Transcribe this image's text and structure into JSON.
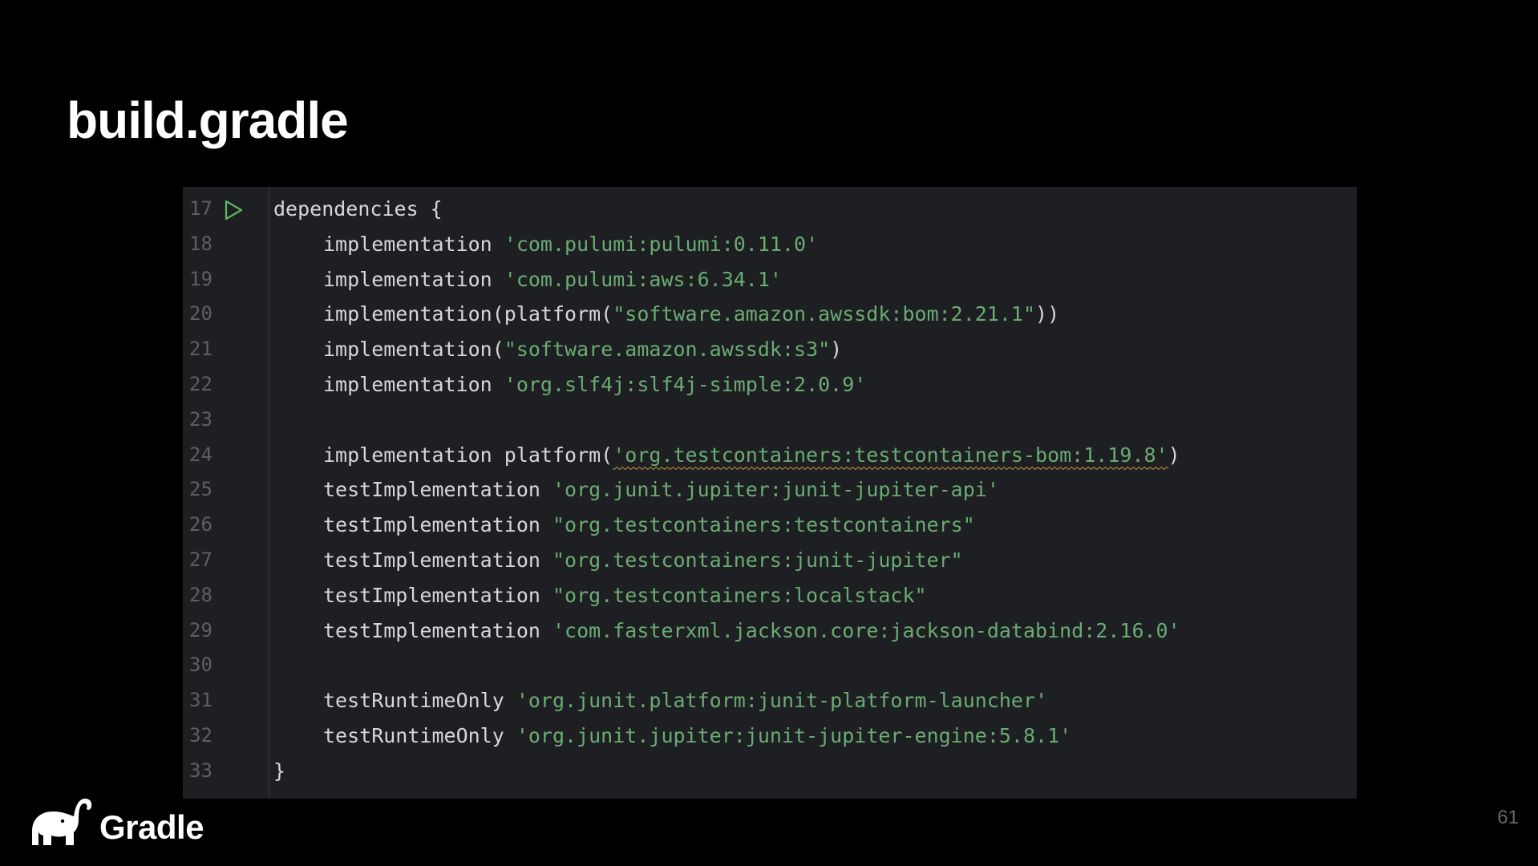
{
  "slide": {
    "title": "build.gradle",
    "page_number": "61"
  },
  "brand": {
    "name": "Gradle",
    "logo_icon": "elephant-icon"
  },
  "editor": {
    "run_icon": "run-gutter-icon",
    "colors": {
      "background": "#1e1f22",
      "code_text": "#d5d7dc",
      "string": "#6aab73",
      "line_number": "#5c5f66",
      "run_icon": "#5fb865",
      "squiggle": "#c7a04a"
    },
    "lines": [
      {
        "number": "17",
        "indent": false,
        "code": "dependencies {",
        "str": "",
        "tail": "",
        "run": true
      },
      {
        "number": "18",
        "indent": true,
        "code": "implementation ",
        "str": "'com.pulumi:pulumi:0.11.0'",
        "tail": ""
      },
      {
        "number": "19",
        "indent": true,
        "code": "implementation ",
        "str": "'com.pulumi:aws:6.34.1'",
        "tail": ""
      },
      {
        "number": "20",
        "indent": true,
        "code": "implementation(platform(",
        "str": "\"software.amazon.awssdk:bom:2.21.1\"",
        "tail": "))"
      },
      {
        "number": "21",
        "indent": true,
        "code": "implementation(",
        "str": "\"software.amazon.awssdk:s3\"",
        "tail": ")"
      },
      {
        "number": "22",
        "indent": true,
        "code": "implementation ",
        "str": "'org.slf4j:slf4j-simple:2.0.9'",
        "tail": ""
      },
      {
        "number": "23",
        "indent": false,
        "code": "",
        "str": "",
        "tail": ""
      },
      {
        "number": "24",
        "indent": true,
        "code": "implementation platform(",
        "str": "'org.testcontainers:testcontainers-bom:1.19.8'",
        "tail": ")",
        "squiggle": true
      },
      {
        "number": "25",
        "indent": true,
        "code": "testImplementation ",
        "str": "'org.junit.jupiter:junit-jupiter-api'",
        "tail": ""
      },
      {
        "number": "26",
        "indent": true,
        "code": "testImplementation ",
        "str": "\"org.testcontainers:testcontainers\"",
        "tail": ""
      },
      {
        "number": "27",
        "indent": true,
        "code": "testImplementation ",
        "str": "\"org.testcontainers:junit-jupiter\"",
        "tail": ""
      },
      {
        "number": "28",
        "indent": true,
        "code": "testImplementation ",
        "str": "\"org.testcontainers:localstack\"",
        "tail": ""
      },
      {
        "number": "29",
        "indent": true,
        "code": "testImplementation ",
        "str": "'com.fasterxml.jackson.core:jackson-databind:2.16.0'",
        "tail": ""
      },
      {
        "number": "30",
        "indent": false,
        "code": "",
        "str": "",
        "tail": ""
      },
      {
        "number": "31",
        "indent": true,
        "code": "testRuntimeOnly ",
        "str": "'org.junit.platform:junit-platform-launcher'",
        "tail": ""
      },
      {
        "number": "32",
        "indent": true,
        "code": "testRuntimeOnly ",
        "str": "'org.junit.jupiter:junit-jupiter-engine:5.8.1'",
        "tail": ""
      },
      {
        "number": "33",
        "indent": false,
        "code": "}",
        "str": "",
        "tail": ""
      }
    ]
  }
}
